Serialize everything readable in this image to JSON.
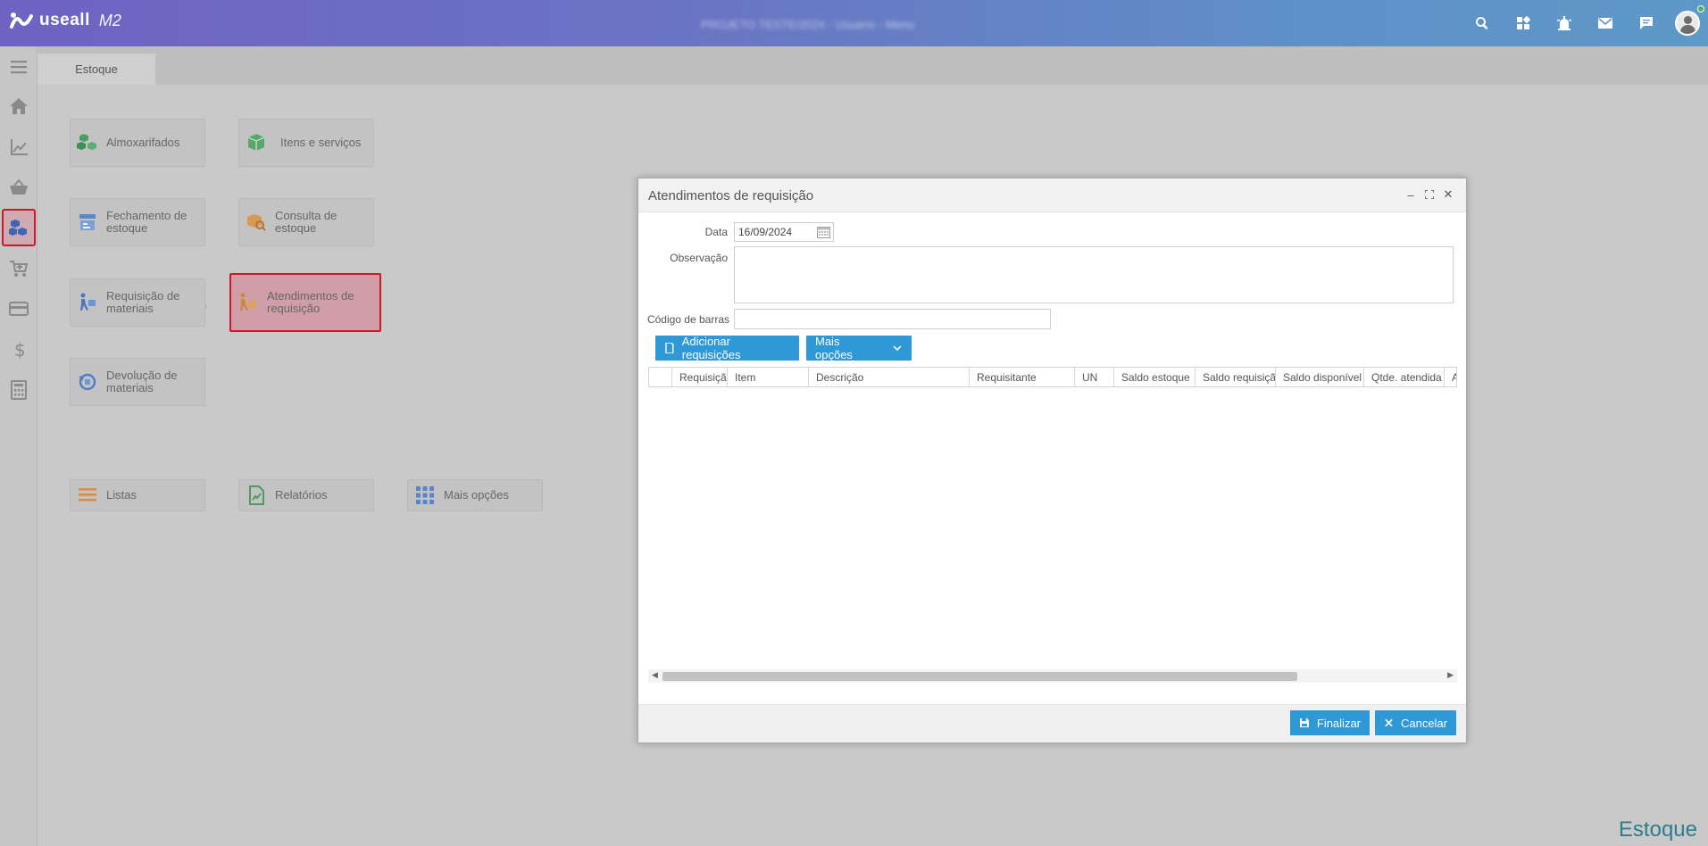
{
  "topbar": {
    "logo_text": "useall",
    "logo_suffix": "M2",
    "blurred_title": "PROJETO TESTE/2024 - Usuário - Menu",
    "icons": [
      "search-icon",
      "apps-icon",
      "alarm-icon",
      "mail-icon",
      "chat-icon",
      "user-avatar"
    ]
  },
  "sidebar": {
    "items": [
      "menu-icon",
      "home-icon",
      "chart-icon",
      "basket-icon",
      "boxes-icon",
      "cart-icon",
      "card-icon",
      "dollar-icon",
      "calculator-icon"
    ],
    "active": "boxes-icon"
  },
  "tabs": [
    {
      "label": "Estoque"
    }
  ],
  "tiles": {
    "almoxarifados": "Almoxarifados",
    "itens": "Itens e serviços",
    "fechamento": "Fechamento de estoque",
    "consulta": "Consulta de estoque",
    "requisicao": "Requisição de materiais",
    "atendimentos": "Atendimentos de requisição",
    "devolucao": "Devolução de materiais",
    "listas": "Listas",
    "relatorios": "Relatórios",
    "mais_opcoes": "Mais opções"
  },
  "footer_label": "Estoque",
  "modal": {
    "title": "Atendimentos de requisição",
    "data_label": "Data",
    "data_value": "16/09/2024",
    "observacao_label": "Observação",
    "observacao_value": "",
    "codigo_label": "Código de barras",
    "codigo_value": "",
    "add_button": "Adicionar requisições",
    "more_button": "Mais opções",
    "columns": [
      "",
      "Requisição",
      "Item",
      "Descrição",
      "Requisitante",
      "UN",
      "Saldo estoque",
      "Saldo requisição",
      "Saldo disponível",
      "Qtde. atendida",
      "A"
    ],
    "rows": [],
    "finalizar": "Finalizar",
    "cancelar": "Cancelar"
  },
  "colors": {
    "accent": "#2f98d6",
    "selected_border": "#d0172a",
    "footer_text": "#2d7c8f"
  }
}
